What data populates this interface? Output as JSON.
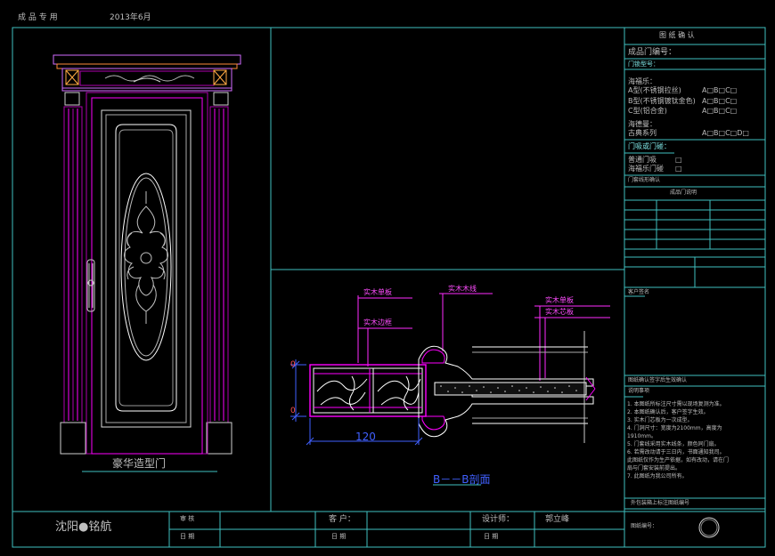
{
  "header": {
    "left_label": "成 品 专 用",
    "date": "2013年6月"
  },
  "door": {
    "caption": "豪华造型门"
  },
  "section": {
    "labels": {
      "l1": "实木单板",
      "l2": "实木边框",
      "l3": "实木木线",
      "l4": "实木单板",
      "l5": "实木芯板"
    },
    "dimension": "120",
    "title": "B－－B剖面"
  },
  "right_panel": {
    "title": "图 纸 确 认",
    "product_no": "成品门编号：",
    "hardware_title": "门锁型号：",
    "group1_title": "海福乐：",
    "group1_items": [
      "A型(不锈钢拉丝)",
      "B型(不锈钢镀钛金色)",
      "C型(铝合金)"
    ],
    "group2_title": "海德曼：",
    "group2_items": [
      "古典系列"
    ],
    "options_abc": "A□B□C□",
    "options_abcd": "A□B□C□D□",
    "stop_title": "门吸或门碰：",
    "stop_items": [
      "普通门吸",
      "海福乐门碰"
    ],
    "door_line_title": "门套线形确认",
    "inner_title": "成品门说明",
    "remark_title": "客户签名",
    "confirm_line": "图纸确认签字后生效确认",
    "notes_title": "说明事项",
    "notes": [
      "1. 本图纸所标注尺寸需以现场复测为准。",
      "2. 本图纸确认后，客户签字生效。",
      "3. 实木门芯板为一次成型。",
      "4. 门洞尺寸：宽度为2100mm，高度为",
      "1910mm。",
      "5. 门套线采用实木线条，颜色同门扇。",
      "6. 若需改动请于三日内，书面通知我司。",
      "此图纸仅作为生产依据，如有改动，请在门",
      "扇与门套安装前提出。",
      "7. 此图纸为我公司所有。"
    ],
    "footer_note": "外包装箱上标注图纸编号",
    "drawing_no": "图纸编号："
  },
  "title_block": {
    "company": "沈阳●铭航",
    "audit": "审 核",
    "date": "日 期",
    "customer": "客 户：",
    "date2": "日 期",
    "designer": "设计师：",
    "designer_name": "郭立峰",
    "date3": "日 期"
  },
  "colors": {
    "frame": "#3fbfbf",
    "door": "#ff00ff",
    "door_frame": "#b000b0",
    "detail": "#ffffff",
    "dim": "#4060ff"
  }
}
